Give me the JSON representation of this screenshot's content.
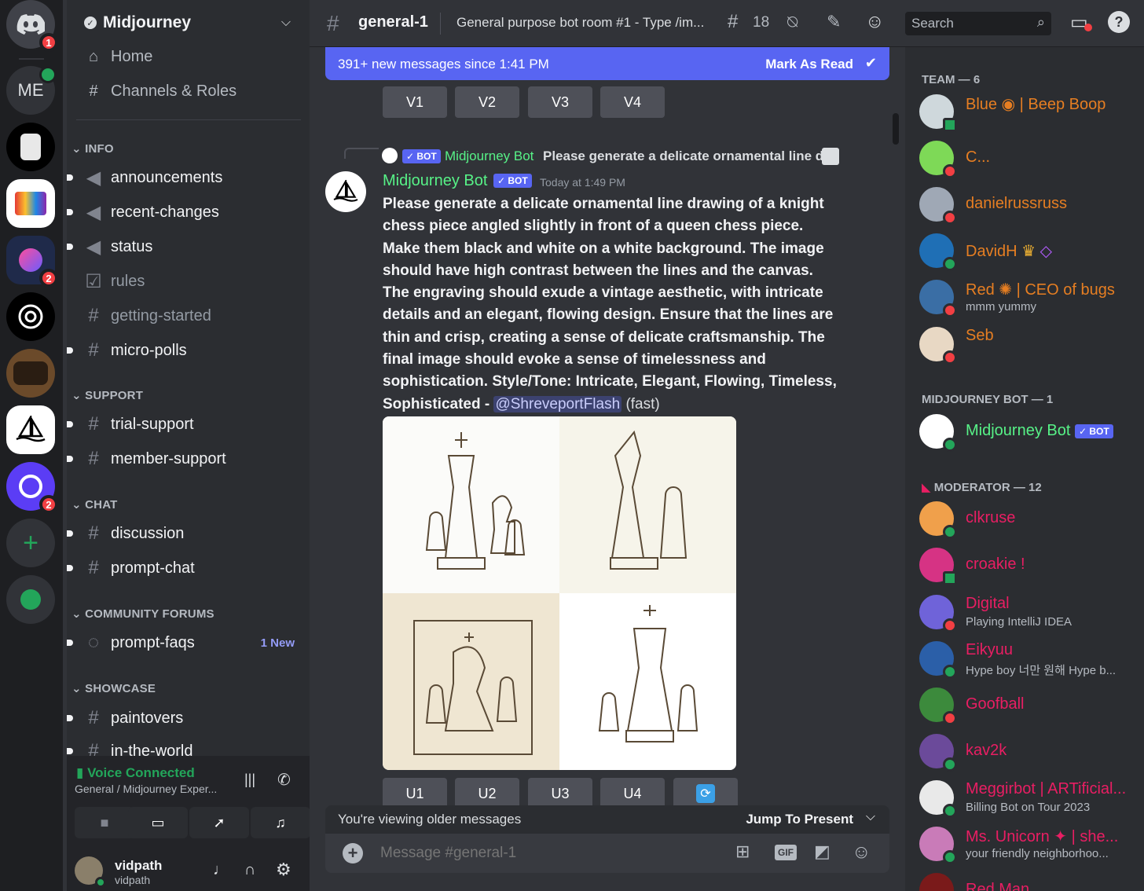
{
  "guilds": {
    "home_badge": "1",
    "me_label": "ME",
    "art_badge": "2",
    "relay_badge": "2"
  },
  "server": {
    "name": "Midjourney"
  },
  "nav": {
    "home": "Home",
    "channels_roles": "Channels & Roles"
  },
  "categories": {
    "info": "INFO",
    "support": "SUPPORT",
    "chat": "CHAT",
    "forums": "COMMUNITY FORUMS",
    "showcase": "SHOWCASE"
  },
  "channels": {
    "announcements": "announcements",
    "recent_changes": "recent-changes",
    "status": "status",
    "rules": "rules",
    "getting_started": "getting-started",
    "micro_polls": "micro-polls",
    "trial_support": "trial-support",
    "member_support": "member-support",
    "discussion": "discussion",
    "prompt_chat": "prompt-chat",
    "prompt_faqs": "prompt-faqs",
    "prompt_faqs_badge": "1 New",
    "paintovers": "paintovers",
    "in_the_world": "in-the-world"
  },
  "voice": {
    "status": "Voice Connected",
    "location": "General / Midjourney Exper..."
  },
  "user": {
    "name": "vidpath",
    "tag": "vidpath"
  },
  "topbar": {
    "channel": "general-1",
    "topic": "General purpose bot room #1 - Type /im...",
    "threads": "18",
    "search": "Search"
  },
  "banner": {
    "text": "391+ new messages since 1:41 PM",
    "action": "Mark As Read"
  },
  "buttons": {
    "v1": "V1",
    "v2": "V2",
    "v3": "V3",
    "v4": "V4",
    "u1": "U1",
    "u2": "U2",
    "u3": "U3",
    "u4": "U4"
  },
  "message": {
    "reply_author": "Midjourney Bot",
    "reply_text": "Please generate a delicate ornamental line d",
    "author": "Midjourney Bot",
    "bot_tag": "BOT",
    "timestamp": "Today at 1:49 PM",
    "body": "Please generate a delicate ornamental line drawing of a knight chess piece angled slightly in front of a queen chess piece. Make them black and white on a white background. The image should have high contrast between the lines and the canvas. The engraving should exude a vintage aesthetic, with intricate details and an elegant, flowing design. Ensure that the lines are thin and crisp, creating a sense of delicate craftsmanship. The final image should evoke a sense of timelessness and sophistication. Style/Tone: Intricate, Elegant, Flowing, Timeless, Sophisticated -",
    "mention": "@ShreveportFlash",
    "suffix": "(fast)"
  },
  "older": {
    "text": "You're viewing older messages",
    "action": "Jump To Present"
  },
  "composer": {
    "placeholder": "Message #general-1",
    "gif": "GIF"
  },
  "members": {
    "team_label": "TEAM — 6",
    "mj_label": "MIDJOURNEY BOT — 1",
    "mod_label": "MODERATOR — 12",
    "blue": "Blue",
    "blue_suffix": "| Beep Boop",
    "c": "C...",
    "daniel": "danielrussruss",
    "davidh": "DavidH",
    "red": "Red",
    "red_suffix": "| CEO of bugs",
    "red_status": "mmm yummy",
    "seb": "Seb",
    "mjbot": "Midjourney Bot",
    "clkruse": "clkruse",
    "croakie": "croakie !",
    "digital": "Digital",
    "digital_status": "Playing IntelliJ IDEA",
    "eikyuu": "Eikyuu",
    "eikyuu_status": "Hype boy 너만 원해 Hype b...",
    "goofball": "Goofball",
    "kav2k": "kav2k",
    "meggirbot": "Meggirbot | ARTificial...",
    "meggirbot_status": "Billing Bot on Tour 2023",
    "unicorn": "Ms. Unicorn",
    "unicorn_suffix": "| she...",
    "unicorn_status": "your friendly neighborhoo...",
    "redman": "Red Man"
  },
  "colors": {
    "accent": "#5865f2",
    "bot_green": "#57f287",
    "mod_pink": "#e91e63",
    "team_orange": "#e67e22"
  }
}
